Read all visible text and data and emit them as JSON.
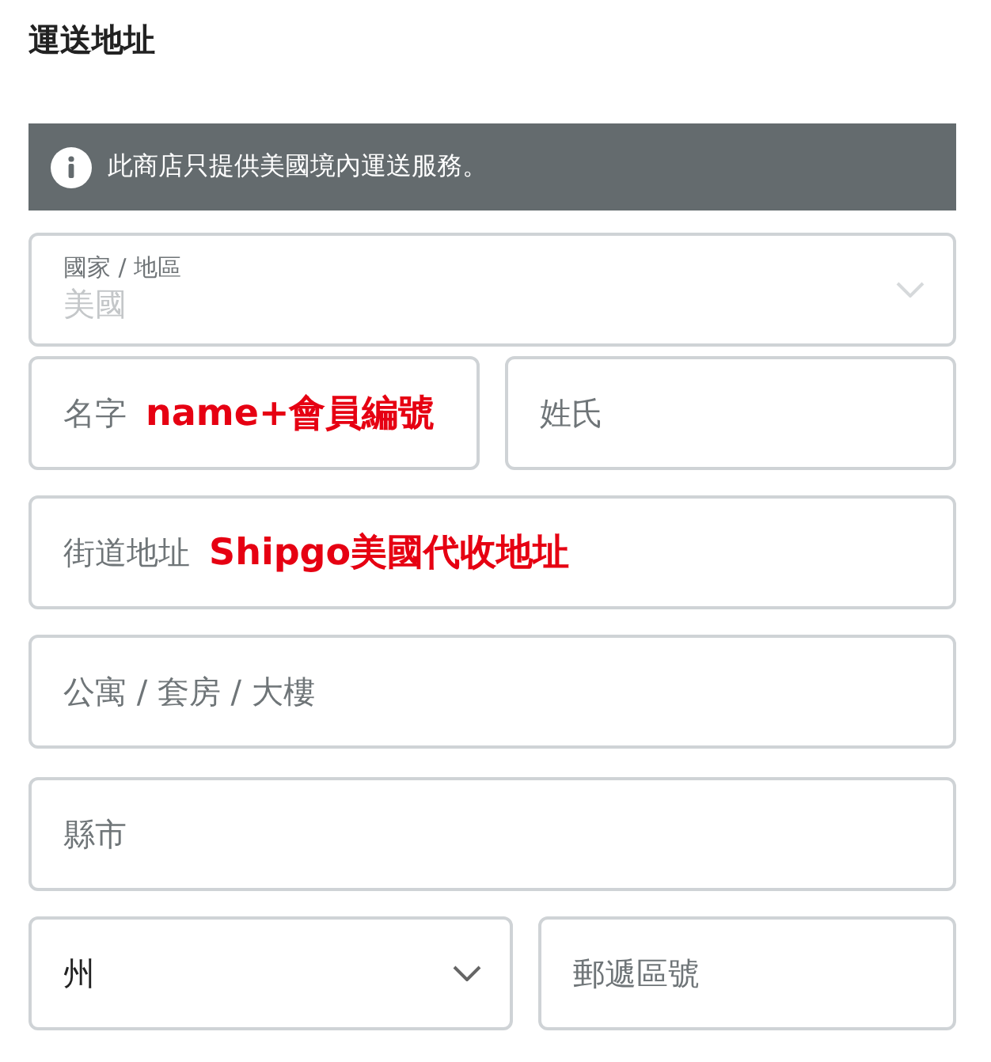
{
  "heading": "運送地址",
  "notice": {
    "text": "此商店只提供美國境內運送服務。"
  },
  "rows": [
    [
      {
        "kind": "select",
        "label": "國家 / 地區",
        "value": "美國",
        "disabled": true
      }
    ],
    [
      {
        "kind": "text",
        "placeholder": "名字",
        "annotation": "name+會員編號"
      },
      {
        "kind": "text",
        "placeholder": "姓氏"
      }
    ],
    [
      {
        "kind": "text",
        "placeholder": "街道地址",
        "annotation": "Shipgo美國代收地址"
      }
    ],
    [
      {
        "kind": "text",
        "placeholder": "公寓 / 套房 / 大樓"
      }
    ],
    [
      {
        "kind": "text",
        "placeholder": "縣市"
      }
    ],
    [
      {
        "kind": "select",
        "value": "州",
        "disabled": false
      },
      {
        "kind": "text",
        "placeholder": "郵遞區號"
      }
    ]
  ]
}
